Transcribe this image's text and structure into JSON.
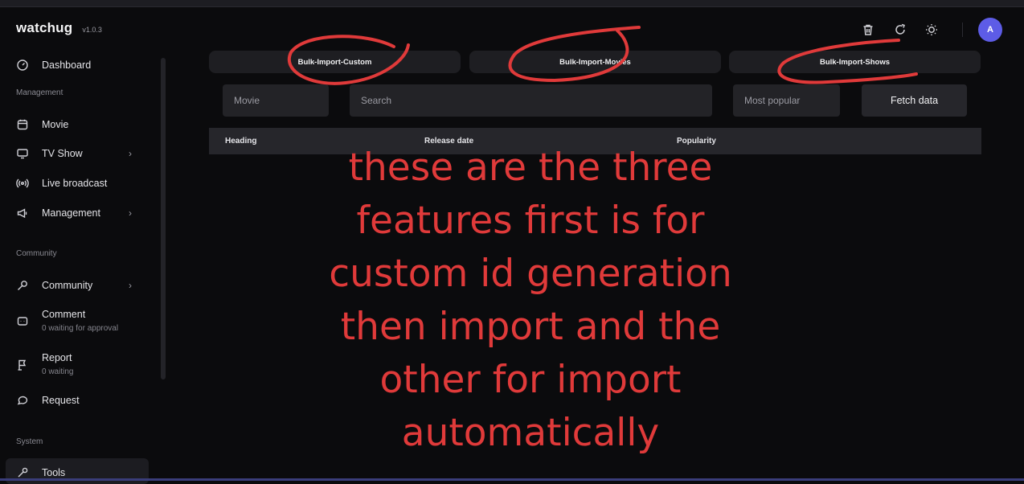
{
  "brand": {
    "name": "watchug",
    "version": "v1.0.3"
  },
  "sidebar": {
    "dashboard": "Dashboard",
    "sections": {
      "management": "Management",
      "community": "Community",
      "system": "System"
    },
    "items": {
      "movie": "Movie",
      "tv_show": "TV Show",
      "live_broadcast": "Live broadcast",
      "management": "Management",
      "community": "Community",
      "comment": "Comment",
      "comment_sub": "0 waiting for approval",
      "report": "Report",
      "report_sub": "0 waiting",
      "request": "Request",
      "tools": "Tools"
    }
  },
  "header": {
    "avatar_initial": "A",
    "icons": [
      "trash-icon",
      "refresh-icon",
      "sun-icon"
    ]
  },
  "tabs": [
    "Bulk-Import-Custom",
    "Bulk-Import-Movies",
    "Bulk-Import-Shows"
  ],
  "filters": {
    "type_value": "Movie",
    "search_placeholder": "Search",
    "sort_value": "Most popular",
    "fetch_label": "Fetch data"
  },
  "table": {
    "columns": [
      "Heading",
      "Release date",
      "Popularity"
    ]
  },
  "annotation": {
    "color": "#e03a3a",
    "lines": [
      "these are the three",
      "features first is for",
      "custom id generation",
      "then import and the",
      "other for import",
      "automatically"
    ]
  },
  "colors": {
    "accent": "#5d5ce6",
    "background": "#0b0b0d",
    "annotation": "#e03a3a"
  }
}
